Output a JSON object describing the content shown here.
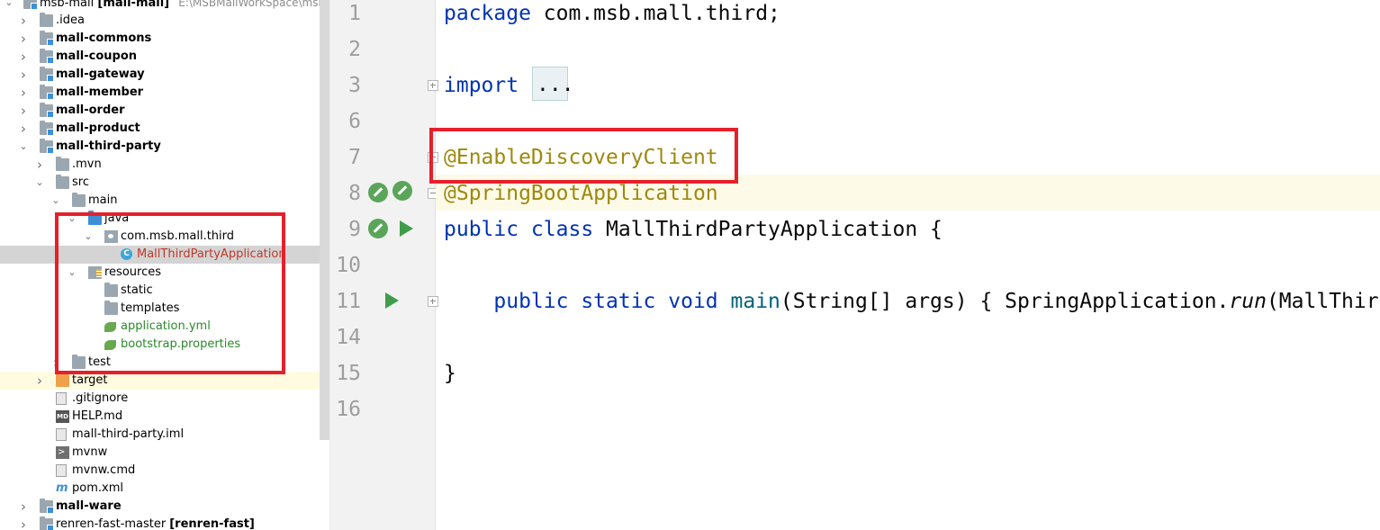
{
  "tree": {
    "root": {
      "name": "msb-mall",
      "module": "[mall-mall]",
      "path": "E:\\MSBMallWorkSpace\\msb-mal"
    },
    "items": [
      {
        "label": ".idea",
        "indent": 1,
        "arrow": "right",
        "icon": "folder-icon",
        "bold": false
      },
      {
        "label": "mall-commons",
        "indent": 1,
        "arrow": "right",
        "icon": "module-folder-icon",
        "bold": true
      },
      {
        "label": "mall-coupon",
        "indent": 1,
        "arrow": "right",
        "icon": "module-folder-icon",
        "bold": true
      },
      {
        "label": "mall-gateway",
        "indent": 1,
        "arrow": "right",
        "icon": "module-folder-icon",
        "bold": true
      },
      {
        "label": "mall-member",
        "indent": 1,
        "arrow": "right",
        "icon": "module-folder-icon",
        "bold": true
      },
      {
        "label": "mall-order",
        "indent": 1,
        "arrow": "right",
        "icon": "module-folder-icon",
        "bold": true
      },
      {
        "label": "mall-product",
        "indent": 1,
        "arrow": "right",
        "icon": "module-folder-icon",
        "bold": true
      },
      {
        "label": "mall-third-party",
        "indent": 1,
        "arrow": "down",
        "icon": "module-folder-icon",
        "bold": true
      },
      {
        "label": ".mvn",
        "indent": 2,
        "arrow": "right",
        "icon": "folder-icon",
        "bold": false
      },
      {
        "label": "src",
        "indent": 2,
        "arrow": "down",
        "icon": "folder-icon",
        "bold": false
      },
      {
        "label": "main",
        "indent": 3,
        "arrow": "down",
        "icon": "folder-icon",
        "bold": false
      },
      {
        "label": "java",
        "indent": 4,
        "arrow": "down",
        "icon": "source-folder-icon",
        "bold": false
      },
      {
        "label": "com.msb.mall.third",
        "indent": 5,
        "arrow": "down",
        "icon": "package-icon",
        "bold": false
      },
      {
        "label": "MallThirdPartyApplication",
        "indent": 6,
        "arrow": "",
        "icon": "spring-class-icon",
        "bold": false
      },
      {
        "label": "resources",
        "indent": 4,
        "arrow": "down",
        "icon": "resources-folder-icon",
        "bold": false
      },
      {
        "label": "static",
        "indent": 5,
        "arrow": "",
        "icon": "folder-icon",
        "bold": false
      },
      {
        "label": "templates",
        "indent": 5,
        "arrow": "",
        "icon": "folder-icon",
        "bold": false
      },
      {
        "label": "application.yml",
        "indent": 5,
        "arrow": "",
        "icon": "spring-leaf-icon",
        "bold": false
      },
      {
        "label": "bootstrap.properties",
        "indent": 5,
        "arrow": "",
        "icon": "spring-leaf-icon",
        "bold": false
      },
      {
        "label": "test",
        "indent": 3,
        "arrow": "right",
        "icon": "folder-icon",
        "bold": false
      },
      {
        "label": "target",
        "indent": 2,
        "arrow": "right",
        "icon": "excluded-folder-icon",
        "bold": false
      },
      {
        "label": ".gitignore",
        "indent": 2,
        "arrow": "",
        "icon": "gitignore-file-icon",
        "bold": false
      },
      {
        "label": "HELP.md",
        "indent": 2,
        "arrow": "",
        "icon": "markdown-file-icon",
        "bold": false
      },
      {
        "label": "mall-third-party.iml",
        "indent": 2,
        "arrow": "",
        "icon": "iml-file-icon",
        "bold": false
      },
      {
        "label": "mvnw",
        "indent": 2,
        "arrow": "",
        "icon": "shell-file-icon",
        "bold": false
      },
      {
        "label": "mvnw.cmd",
        "indent": 2,
        "arrow": "",
        "icon": "text-file-icon",
        "bold": false
      },
      {
        "label": "pom.xml",
        "indent": 2,
        "arrow": "",
        "icon": "maven-icon",
        "bold": false
      },
      {
        "label": "mall-ware",
        "indent": 1,
        "arrow": "right",
        "icon": "module-folder-icon",
        "bold": true
      },
      {
        "label": "renren-fast-master",
        "suffix": "[renren-fast]",
        "indent": 1,
        "arrow": "right",
        "icon": "module-folder-icon",
        "bold": false
      }
    ],
    "selected_label": "MallThirdPartyApplication",
    "colors": {
      "selected_bg": "#d4d4d4",
      "spring_file_text": "#2b8a2b",
      "class_text": "#c0392b"
    }
  },
  "editor": {
    "lines": [
      {
        "num": "1",
        "tokens": [
          [
            "kw",
            "package"
          ],
          [
            "",
            "com.msb.mall.third;"
          ]
        ]
      },
      {
        "num": "2",
        "tokens": []
      },
      {
        "num": "3",
        "tokens": [
          [
            "kw",
            "import"
          ],
          [
            "",
            "   "
          ]
        ]
      },
      {
        "num": "6",
        "tokens": []
      },
      {
        "num": "7",
        "tokens": [
          [
            "anno",
            "@EnableDiscoveryClient"
          ]
        ]
      },
      {
        "num": "8",
        "tokens": [
          [
            "anno",
            "@SpringBootApplication"
          ]
        ]
      },
      {
        "num": "9",
        "tokens": [
          [
            "kw",
            "public class "
          ],
          [
            "",
            "MallThirdPartyApplication {"
          ]
        ]
      },
      {
        "num": "10",
        "tokens": []
      },
      {
        "num": "11",
        "tokens": [
          [
            "",
            "    "
          ],
          [
            "kw",
            "public static void "
          ],
          [
            "fn",
            "main"
          ],
          [
            "",
            "(String[] args) { SpringApplication."
          ],
          [
            "it",
            "run"
          ],
          [
            "",
            "(MallThir"
          ]
        ]
      },
      {
        "num": "14",
        "tokens": []
      },
      {
        "num": "15",
        "tokens": [
          [
            "",
            "}"
          ]
        ]
      },
      {
        "num": "16",
        "tokens": []
      }
    ],
    "folded_import": "...",
    "colors": {
      "keyword": "#0033b3",
      "annotation": "#9e880d",
      "highlight_box": "#e6202b"
    }
  }
}
